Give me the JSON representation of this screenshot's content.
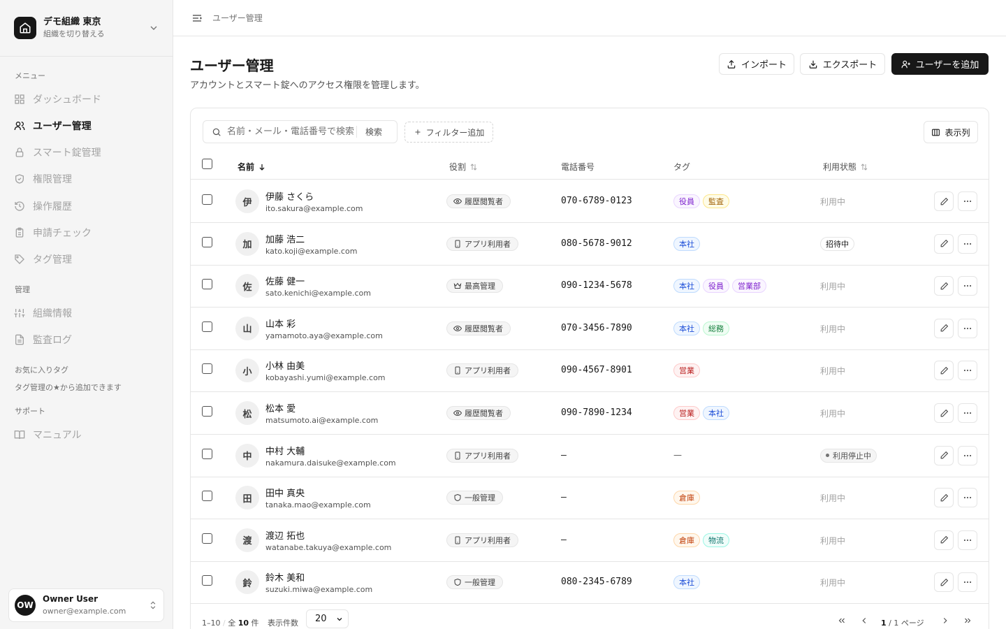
{
  "org": {
    "name": "デモ組織 東京",
    "subtitle": "組織を切り替える"
  },
  "sidebar": {
    "sections": {
      "menu": "メニュー",
      "admin": "管理",
      "favorites": "お気に入りタグ",
      "support": "サポート"
    },
    "items": [
      {
        "label": "ダッシュボード",
        "icon": "grid-icon"
      },
      {
        "label": "ユーザー管理",
        "icon": "users-icon",
        "active": true
      },
      {
        "label": "スマート錠管理",
        "icon": "lock-icon"
      },
      {
        "label": "権限管理",
        "icon": "shield-icon"
      },
      {
        "label": "操作履歴",
        "icon": "history-icon"
      },
      {
        "label": "申請チェック",
        "icon": "clipboard-icon"
      },
      {
        "label": "タグ管理",
        "icon": "tag-icon"
      },
      {
        "label": "組織情報",
        "icon": "sliders-icon"
      },
      {
        "label": "監査ログ",
        "icon": "file-icon"
      },
      {
        "label": "マニュアル",
        "icon": "book-icon"
      }
    ],
    "favorites_hint": "タグ管理の★から追加できます"
  },
  "user": {
    "initials": "OW",
    "name": "Owner User",
    "email": "owner@example.com"
  },
  "topbar": {
    "breadcrumb": "ユーザー管理"
  },
  "page": {
    "title": "ユーザー管理",
    "subtitle": "アカウントとスマート錠へのアクセス権限を管理します。"
  },
  "actions": {
    "import": "インポート",
    "export": "エクスポート",
    "add_user": "ユーザーを追加"
  },
  "toolbar": {
    "search_placeholder": "名前・メール・電話番号で検索",
    "search_button": "検索",
    "filter": "フィルター追加",
    "columns": "表示列"
  },
  "table": {
    "headers": {
      "name": "名前",
      "role": "役割",
      "phone": "電話番号",
      "tags": "タグ",
      "status": "利用状態"
    },
    "rows": [
      {
        "initial": "伊",
        "name": "伊藤 さくら",
        "email": "ito.sakura@example.com",
        "role": "履歴閲覧者",
        "role_icon": "eye-icon",
        "phone": "070-6789-0123",
        "tags": [
          "役員",
          "監査"
        ],
        "status": "利用中",
        "status_type": "active"
      },
      {
        "initial": "加",
        "name": "加藤 浩二",
        "email": "kato.koji@example.com",
        "role": "アプリ利用者",
        "role_icon": "phone-icon",
        "phone": "080-5678-9012",
        "tags": [
          "本社"
        ],
        "status": "招待中",
        "status_type": "invited"
      },
      {
        "initial": "佐",
        "name": "佐藤 健一",
        "email": "sato.kenichi@example.com",
        "role": "最高管理",
        "role_icon": "crown-icon",
        "phone": "090-1234-5678",
        "tags": [
          "本社",
          "役員",
          "営業部"
        ],
        "status": "利用中",
        "status_type": "active"
      },
      {
        "initial": "山",
        "name": "山本 彩",
        "email": "yamamoto.aya@example.com",
        "role": "履歴閲覧者",
        "role_icon": "eye-icon",
        "phone": "070-3456-7890",
        "tags": [
          "本社",
          "総務"
        ],
        "status": "利用中",
        "status_type": "active"
      },
      {
        "initial": "小",
        "name": "小林 由美",
        "email": "kobayashi.yumi@example.com",
        "role": "アプリ利用者",
        "role_icon": "phone-icon",
        "phone": "090-4567-8901",
        "tags": [
          "営業"
        ],
        "status": "利用中",
        "status_type": "active"
      },
      {
        "initial": "松",
        "name": "松本 愛",
        "email": "matsumoto.ai@example.com",
        "role": "履歴閲覧者",
        "role_icon": "eye-icon",
        "phone": "090-7890-1234",
        "tags": [
          "営業",
          "本社"
        ],
        "status": "利用中",
        "status_type": "active"
      },
      {
        "initial": "中",
        "name": "中村 大輔",
        "email": "nakamura.daisuke@example.com",
        "role": "アプリ利用者",
        "role_icon": "phone-icon",
        "phone": "–",
        "tags": [],
        "tags_empty": "—",
        "status": "利用停止中",
        "status_type": "stopped"
      },
      {
        "initial": "田",
        "name": "田中 真央",
        "email": "tanaka.mao@example.com",
        "role": "一般管理",
        "role_icon": "shield-icon",
        "phone": "–",
        "tags": [
          "倉庫"
        ],
        "status": "利用中",
        "status_type": "active"
      },
      {
        "initial": "渡",
        "name": "渡辺 拓也",
        "email": "watanabe.takuya@example.com",
        "role": "アプリ利用者",
        "role_icon": "phone-icon",
        "phone": "–",
        "tags": [
          "倉庫",
          "物流"
        ],
        "status": "利用中",
        "status_type": "active"
      },
      {
        "initial": "鈴",
        "name": "鈴木 美和",
        "email": "suzuki.miwa@example.com",
        "role": "一般管理",
        "role_icon": "shield-icon",
        "phone": "080-2345-6789",
        "tags": [
          "本社"
        ],
        "status": "利用中",
        "status_type": "active"
      }
    ]
  },
  "tag_colors": {
    "役員": {
      "bg": "#faf5ff",
      "border": "#e9d5ff",
      "fg": "#7e22ce"
    },
    "監査": {
      "bg": "#fefce8",
      "border": "#fde68a",
      "fg": "#a16207"
    },
    "本社": {
      "bg": "#eff6ff",
      "border": "#bfdbfe",
      "fg": "#1d4ed8"
    },
    "営業部": {
      "bg": "#faf5ff",
      "border": "#e9d5ff",
      "fg": "#7e22ce"
    },
    "総務": {
      "bg": "#f0fdf4",
      "border": "#bbf7d0",
      "fg": "#15803d"
    },
    "営業": {
      "bg": "#fef2f2",
      "border": "#fecaca",
      "fg": "#b91c1c"
    },
    "倉庫": {
      "bg": "#fff7ed",
      "border": "#fed7aa",
      "fg": "#c2410c"
    },
    "物流": {
      "bg": "#f0fdfa",
      "border": "#99f6e4",
      "fg": "#0f766e"
    }
  },
  "pagination": {
    "range": "1–10",
    "total_prefix": "全",
    "total": "10",
    "total_suffix": "件",
    "per_page_label": "表示件数",
    "per_page": "20",
    "current": "1",
    "pages": "1",
    "pages_suffix": "ページ"
  }
}
